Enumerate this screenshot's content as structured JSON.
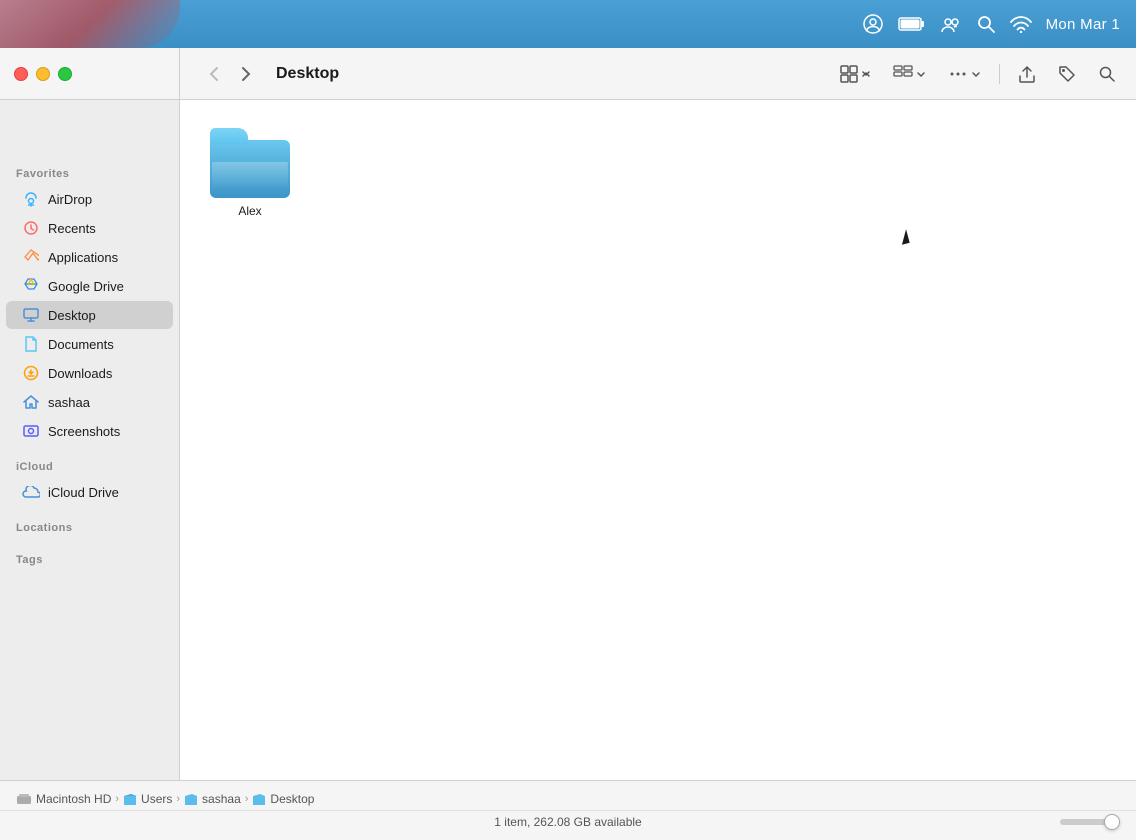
{
  "menubar": {
    "time": "Mon Mar 1",
    "icons": [
      "user-circle",
      "battery",
      "user-switch",
      "search",
      "wifi"
    ]
  },
  "window": {
    "title": "Desktop",
    "traffic_lights": {
      "close": "close",
      "minimize": "minimize",
      "maximize": "maximize"
    }
  },
  "toolbar": {
    "back_label": "‹",
    "forward_label": "›",
    "title": "Desktop",
    "view_grid_label": "⊞",
    "view_chevron_label": "⌃",
    "view_group_label": "⊞⊞",
    "view_group_chevron": "⌃",
    "more_label": "•••",
    "share_label": "↑",
    "tag_label": "◇",
    "search_label": "⌕"
  },
  "sidebar": {
    "favorites_label": "Favorites",
    "icloud_label": "iCloud",
    "locations_label": "Locations",
    "tags_label": "Tags",
    "items": [
      {
        "id": "airdrop",
        "label": "AirDrop",
        "icon": "airdrop"
      },
      {
        "id": "recents",
        "label": "Recents",
        "icon": "recents"
      },
      {
        "id": "applications",
        "label": "Applications",
        "icon": "applications"
      },
      {
        "id": "google-drive",
        "label": "Google Drive",
        "icon": "gdrive"
      },
      {
        "id": "desktop",
        "label": "Desktop",
        "icon": "desktop",
        "active": true
      },
      {
        "id": "documents",
        "label": "Documents",
        "icon": "documents"
      },
      {
        "id": "downloads",
        "label": "Downloads",
        "icon": "downloads"
      },
      {
        "id": "sashaa",
        "label": "sashaa",
        "icon": "home"
      },
      {
        "id": "screenshots",
        "label": "Screenshots",
        "icon": "screenshots"
      }
    ],
    "icloud_items": [
      {
        "id": "icloud-drive",
        "label": "iCloud Drive",
        "icon": "icloud"
      }
    ]
  },
  "files": [
    {
      "name": "Alex",
      "type": "folder"
    }
  ],
  "breadcrumb": {
    "items": [
      {
        "label": "Macintosh HD",
        "type": "hd"
      },
      {
        "label": "Users",
        "type": "folder"
      },
      {
        "label": "sashaa",
        "type": "folder"
      },
      {
        "label": "Desktop",
        "type": "folder"
      }
    ],
    "separator": "›"
  },
  "status": {
    "text": "1 item, 262.08 GB available"
  }
}
